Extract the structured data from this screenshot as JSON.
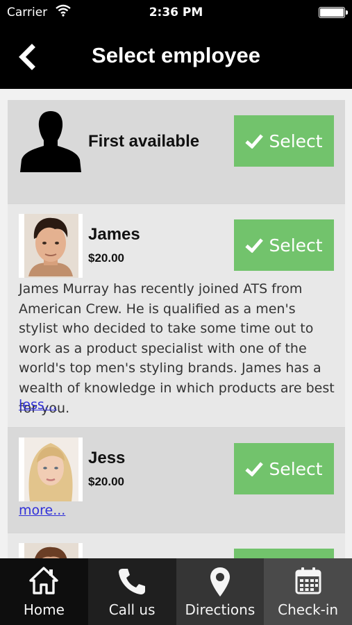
{
  "status_bar": {
    "carrier": "Carrier",
    "time": "2:36 PM"
  },
  "header": {
    "title": "Select employee"
  },
  "employees": [
    {
      "name": "First available",
      "select_label": "Select"
    },
    {
      "name": "James",
      "price": "$20.00",
      "bio": "James Murray has recently joined ATS from American Crew. He is qualified as a men's stylist who decided to take some time out to work as a product specialist with one of the world's top men's styling brands. James has a wealth of knowledge in which products are best for you.",
      "toggle_label": "less...",
      "select_label": "Select"
    },
    {
      "name": "Jess",
      "price": "$20.00",
      "toggle_label": "more...",
      "select_label": "Select"
    }
  ],
  "tab_bar": {
    "tabs": [
      {
        "label": "Home",
        "icon": "home-icon"
      },
      {
        "label": "Call us",
        "icon": "phone-icon"
      },
      {
        "label": "Directions",
        "icon": "map-pin-icon"
      },
      {
        "label": "Check-in",
        "icon": "calendar-icon"
      }
    ]
  },
  "colors": {
    "select_button": "#72c36c",
    "link": "#2f2fd9",
    "header": "#000000"
  }
}
